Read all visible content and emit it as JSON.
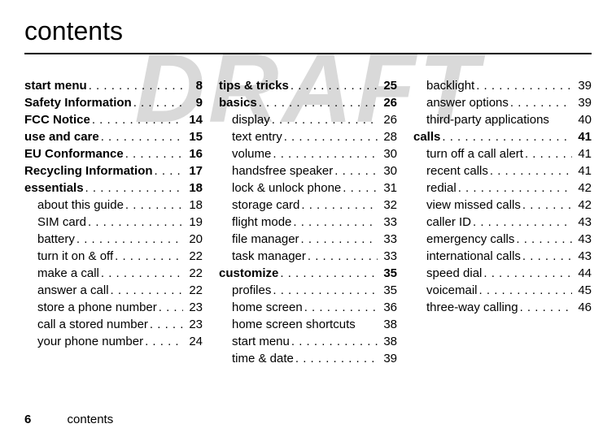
{
  "title": "contents",
  "watermark": "DRAFT",
  "footer": {
    "page_number": "6",
    "label": "contents"
  },
  "entries": [
    {
      "col": 0,
      "bold": true,
      "sub": false,
      "label": "start menu",
      "page": "8",
      "dots": true
    },
    {
      "col": 0,
      "bold": true,
      "sub": false,
      "label": "Safety Information",
      "page": "9",
      "dots": true
    },
    {
      "col": 0,
      "bold": true,
      "sub": false,
      "label": "FCC Notice",
      "page": "14",
      "dots": true
    },
    {
      "col": 0,
      "bold": true,
      "sub": false,
      "label": "use and care",
      "page": "15",
      "dots": true
    },
    {
      "col": 0,
      "bold": true,
      "sub": false,
      "label": "EU Conformance",
      "page": "16",
      "dots": true
    },
    {
      "col": 0,
      "bold": true,
      "sub": false,
      "label": "Recycling Information",
      "page": "17",
      "dots": true
    },
    {
      "col": 0,
      "bold": true,
      "sub": false,
      "label": "essentials",
      "page": "18",
      "dots": true
    },
    {
      "col": 0,
      "bold": false,
      "sub": true,
      "label": "about this guide",
      "page": "18",
      "dots": true
    },
    {
      "col": 0,
      "bold": false,
      "sub": true,
      "label": "SIM card",
      "page": "19",
      "dots": true
    },
    {
      "col": 0,
      "bold": false,
      "sub": true,
      "label": "battery",
      "page": "20",
      "dots": true
    },
    {
      "col": 0,
      "bold": false,
      "sub": true,
      "label": "turn it on & off",
      "page": "22",
      "dots": true
    },
    {
      "col": 0,
      "bold": false,
      "sub": true,
      "label": "make a call",
      "page": "22",
      "dots": true
    },
    {
      "col": 0,
      "bold": false,
      "sub": true,
      "label": "answer a call",
      "page": "22",
      "dots": true
    },
    {
      "col": 0,
      "bold": false,
      "sub": true,
      "label": "store a phone number",
      "page": "23",
      "dots": true
    },
    {
      "col": 0,
      "bold": false,
      "sub": true,
      "label": "call a stored number",
      "page": "23",
      "dots": true
    },
    {
      "col": 0,
      "bold": false,
      "sub": true,
      "label": "your phone number",
      "page": "24",
      "dots": true
    },
    {
      "col": 1,
      "bold": true,
      "sub": false,
      "label": "tips & tricks",
      "page": "25",
      "dots": true
    },
    {
      "col": 1,
      "bold": true,
      "sub": false,
      "label": "basics",
      "page": "26",
      "dots": true
    },
    {
      "col": 1,
      "bold": false,
      "sub": true,
      "label": "display",
      "page": "26",
      "dots": true
    },
    {
      "col": 1,
      "bold": false,
      "sub": true,
      "label": "text entry",
      "page": "28",
      "dots": true
    },
    {
      "col": 1,
      "bold": false,
      "sub": true,
      "label": "volume",
      "page": "30",
      "dots": true
    },
    {
      "col": 1,
      "bold": false,
      "sub": true,
      "label": "handsfree speaker",
      "page": "30",
      "dots": true
    },
    {
      "col": 1,
      "bold": false,
      "sub": true,
      "label": "lock & unlock phone",
      "page": "31",
      "dots": true
    },
    {
      "col": 1,
      "bold": false,
      "sub": true,
      "label": "storage card",
      "page": "32",
      "dots": true
    },
    {
      "col": 1,
      "bold": false,
      "sub": true,
      "label": "flight mode",
      "page": "33",
      "dots": true
    },
    {
      "col": 1,
      "bold": false,
      "sub": true,
      "label": "file manager",
      "page": "33",
      "dots": true
    },
    {
      "col": 1,
      "bold": false,
      "sub": true,
      "label": "task manager",
      "page": "33",
      "dots": true
    },
    {
      "col": 1,
      "bold": true,
      "sub": false,
      "label": "customize",
      "page": "35",
      "dots": true
    },
    {
      "col": 1,
      "bold": false,
      "sub": true,
      "label": "profiles",
      "page": "35",
      "dots": true
    },
    {
      "col": 1,
      "bold": false,
      "sub": true,
      "label": "home screen",
      "page": "36",
      "dots": true
    },
    {
      "col": 1,
      "bold": false,
      "sub": true,
      "label": "home screen shortcuts",
      "page": "38",
      "dots": false
    },
    {
      "col": 1,
      "bold": false,
      "sub": true,
      "label": "start menu",
      "page": "38",
      "dots": true
    },
    {
      "col": 1,
      "bold": false,
      "sub": true,
      "label": "time & date",
      "page": "39",
      "dots": true
    },
    {
      "col": 2,
      "bold": false,
      "sub": true,
      "label": "backlight",
      "page": "39",
      "dots": true
    },
    {
      "col": 2,
      "bold": false,
      "sub": true,
      "label": "answer options",
      "page": "39",
      "dots": true
    },
    {
      "col": 2,
      "bold": false,
      "sub": true,
      "label": "third-party applications",
      "page": "40",
      "dots": false
    },
    {
      "col": 2,
      "bold": true,
      "sub": false,
      "label": "calls",
      "page": "41",
      "dots": true
    },
    {
      "col": 2,
      "bold": false,
      "sub": true,
      "label": "turn off a call alert",
      "page": "41",
      "dots": true
    },
    {
      "col": 2,
      "bold": false,
      "sub": true,
      "label": "recent calls",
      "page": "41",
      "dots": true
    },
    {
      "col": 2,
      "bold": false,
      "sub": true,
      "label": "redial",
      "page": "42",
      "dots": true
    },
    {
      "col": 2,
      "bold": false,
      "sub": true,
      "label": "view missed calls",
      "page": "42",
      "dots": true
    },
    {
      "col": 2,
      "bold": false,
      "sub": true,
      "label": "caller ID",
      "page": "43",
      "dots": true
    },
    {
      "col": 2,
      "bold": false,
      "sub": true,
      "label": "emergency calls",
      "page": "43",
      "dots": true
    },
    {
      "col": 2,
      "bold": false,
      "sub": true,
      "label": "international calls",
      "page": "43",
      "dots": true
    },
    {
      "col": 2,
      "bold": false,
      "sub": true,
      "label": "speed dial",
      "page": "44",
      "dots": true
    },
    {
      "col": 2,
      "bold": false,
      "sub": true,
      "label": "voicemail",
      "page": "45",
      "dots": true
    },
    {
      "col": 2,
      "bold": false,
      "sub": true,
      "label": "three-way calling",
      "page": "46",
      "dots": true
    }
  ]
}
